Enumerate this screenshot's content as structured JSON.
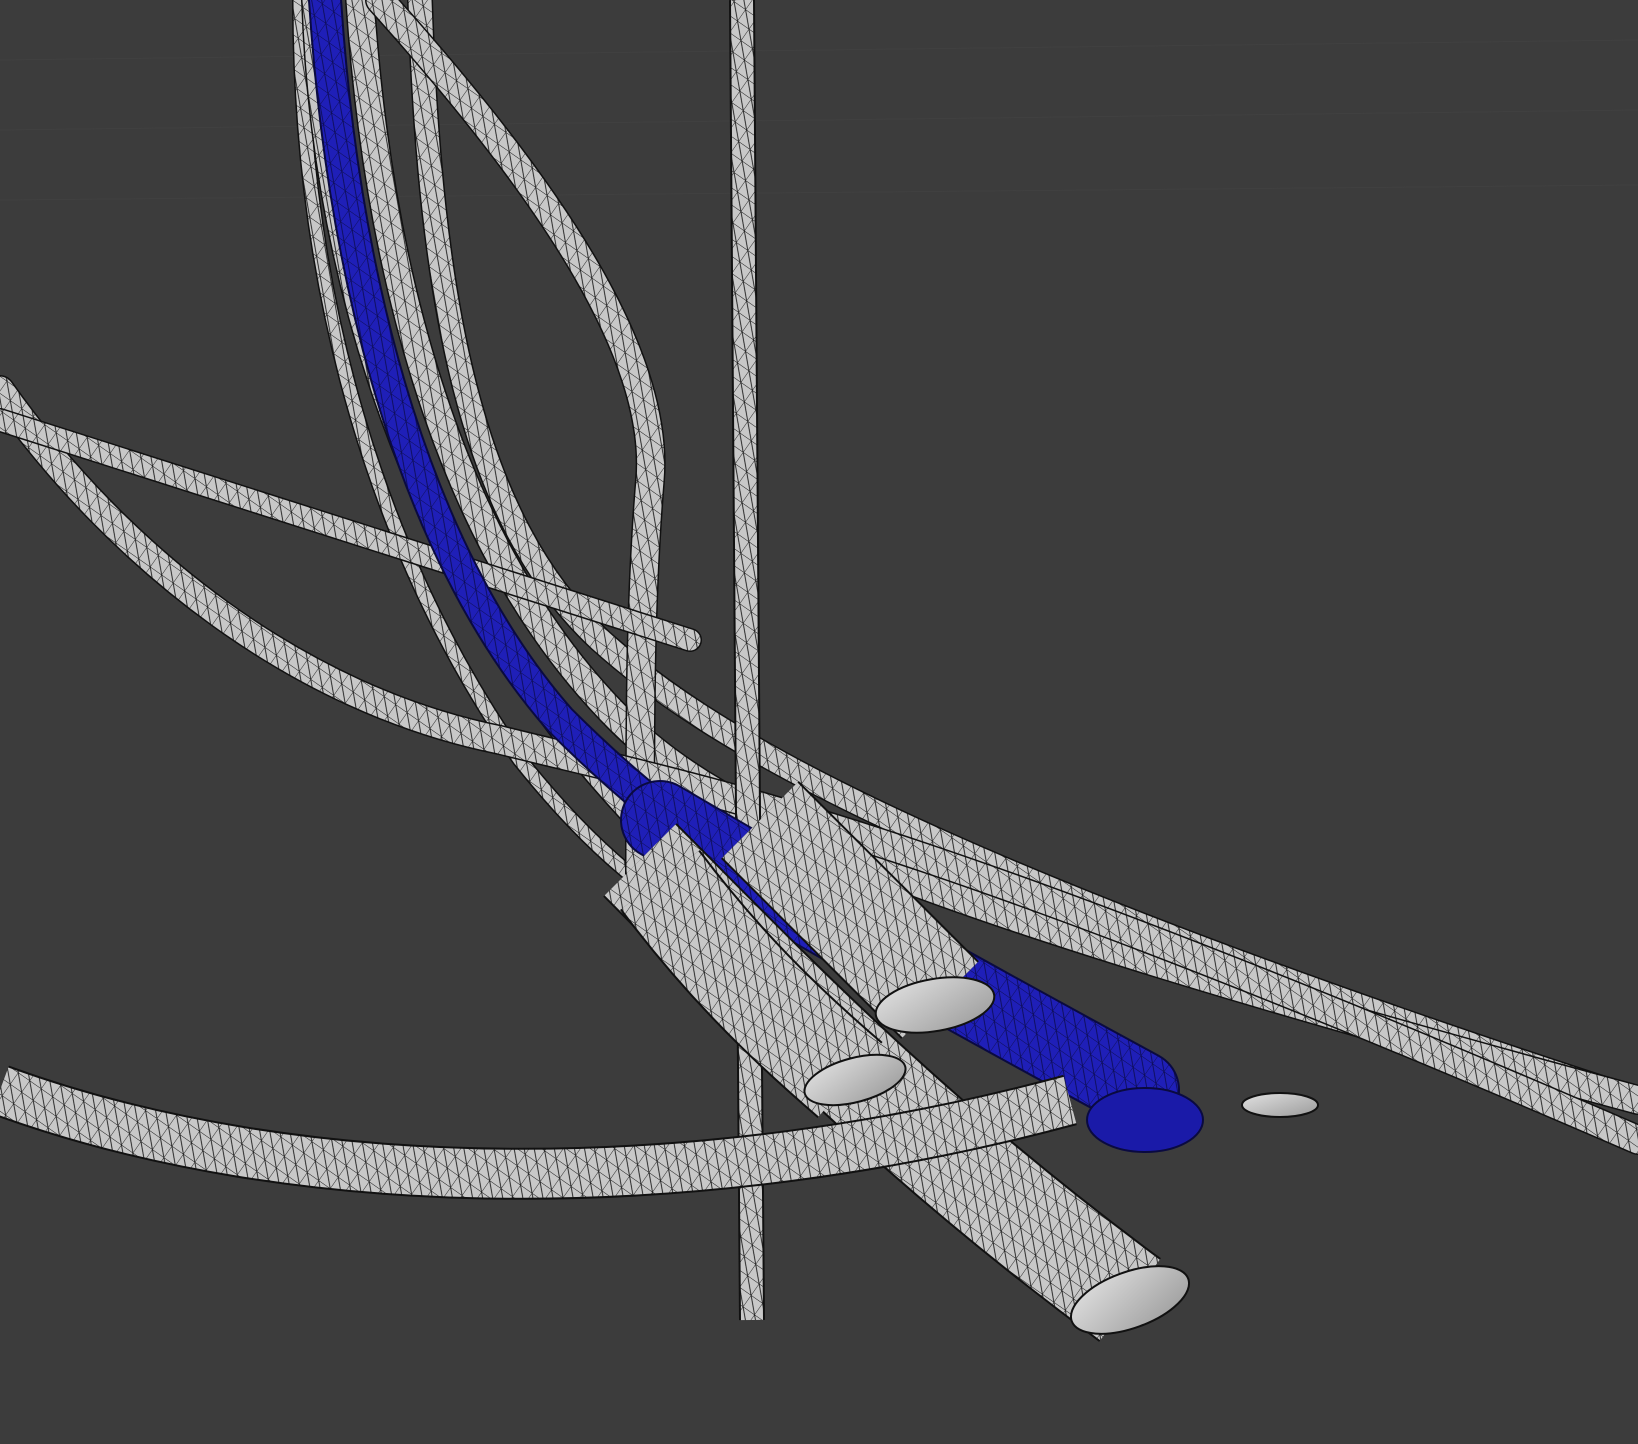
{
  "viewport": {
    "background": "#3c3c3c",
    "grid_color": "#444444",
    "mesh_color": "#c8c8c8",
    "wire_color": "#111111",
    "selected_color": "#1f1fb8",
    "cap_color": "#d6d6d6"
  },
  "scene": {
    "selected_object": "blue-vessel"
  }
}
